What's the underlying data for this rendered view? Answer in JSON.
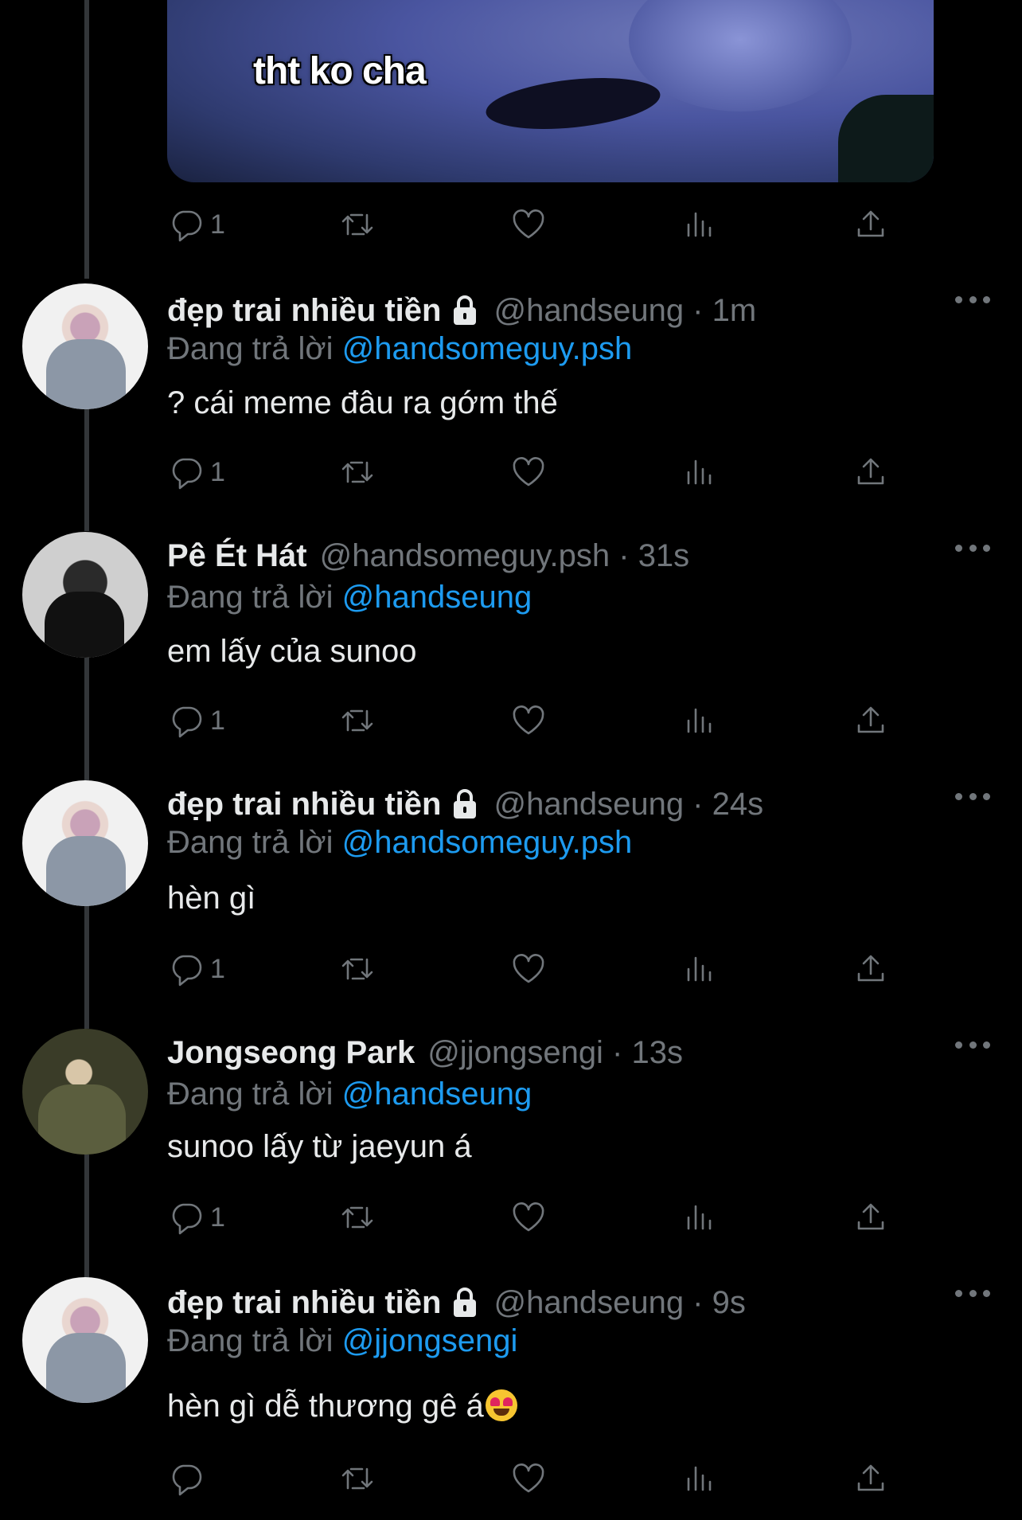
{
  "media": {
    "caption": "tht ko cha"
  },
  "media_actions": {
    "reply_count": "1"
  },
  "tweets": [
    {
      "name": "đẹp trai nhiều tiền",
      "locked": true,
      "handle": "@handseung · 1m",
      "replying_label": "Đang trả lời ",
      "replying_to": "@handsomeguy.psh",
      "text": "? cái meme đâu ra gớm thế",
      "reply_count": "1",
      "avatar": "a"
    },
    {
      "name": "Pê Ét Hát",
      "locked": false,
      "handle": "@handsomeguy.psh · 31s",
      "replying_label": "Đang trả lời ",
      "replying_to": "@handseung",
      "text": "em lấy của sunoo",
      "reply_count": "1",
      "avatar": "b"
    },
    {
      "name": "đẹp trai nhiều tiền",
      "locked": true,
      "handle": "@handseung · 24s",
      "replying_label": "Đang trả lời ",
      "replying_to": "@handsomeguy.psh",
      "text": "hèn gì",
      "reply_count": "1",
      "avatar": "a"
    },
    {
      "name": "Jongseong Park",
      "locked": false,
      "handle": "@jjongsengi · 13s",
      "replying_label": "Đang trả lời ",
      "replying_to": "@handseung",
      "text": "sunoo lấy từ jaeyun á",
      "reply_count": "1",
      "avatar": "c"
    },
    {
      "name": "đẹp trai nhiều tiền",
      "locked": true,
      "handle": "@handseung · 9s",
      "replying_label": "Đang trả lời ",
      "replying_to": "@jjongsengi",
      "text": "hèn gì dễ thương gê á",
      "reply_count": "",
      "avatar": "a"
    }
  ],
  "icons": {
    "reply": "reply-icon",
    "retweet": "retweet-icon",
    "like": "heart-icon",
    "views": "views-icon",
    "share": "share-icon",
    "more": "more-icon",
    "lock": "lock-icon",
    "emoji": "heart-eyes-emoji"
  },
  "colors": {
    "background": "#000000",
    "text": "#e7e9ea",
    "muted": "#71767b",
    "link": "#1d9bf0"
  }
}
